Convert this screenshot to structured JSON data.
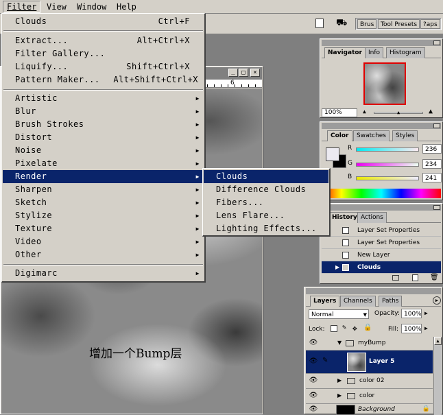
{
  "menubar": {
    "items": [
      "Filter",
      "View",
      "Window",
      "Help"
    ]
  },
  "options_bar": {
    "tabs": [
      "Brus",
      "Tool Presets",
      "?aps"
    ]
  },
  "filter_menu": {
    "top": {
      "label": "Clouds",
      "shortcut": "Ctrl+F"
    },
    "group1": [
      {
        "label": "Extract...",
        "shortcut": "Alt+Ctrl+X"
      },
      {
        "label": "Filter Gallery...",
        "shortcut": ""
      },
      {
        "label": "Liquify...",
        "shortcut": "Shift+Ctrl+X"
      },
      {
        "label": "Pattern Maker...",
        "shortcut": "Alt+Shift+Ctrl+X"
      }
    ],
    "group2": [
      "Artistic",
      "Blur",
      "Brush Strokes",
      "Distort",
      "Noise",
      "Pixelate",
      "Render",
      "Sharpen",
      "Sketch",
      "Stylize",
      "Texture",
      "Video",
      "Other"
    ],
    "group3": [
      "Digimarc"
    ]
  },
  "render_submenu": [
    "Clouds",
    "Difference Clouds",
    "Fibers...",
    "Lens Flare...",
    "Lighting Effects..."
  ],
  "document": {
    "ruler_mark": "6"
  },
  "caption": "增加一个Bump层",
  "navigator": {
    "tabs": [
      "Navigator",
      "Info",
      "Histogram"
    ],
    "zoom": "100%"
  },
  "color": {
    "tabs": [
      "Color",
      "Swatches",
      "Styles"
    ],
    "channels": [
      {
        "label": "R",
        "value": "236"
      },
      {
        "label": "G",
        "value": "234"
      },
      {
        "label": "B",
        "value": "241"
      }
    ]
  },
  "history": {
    "tabs": [
      "History",
      "Actions"
    ],
    "items": [
      "Layer Set Properties",
      "Layer Set Properties",
      "New Layer",
      "Clouds"
    ]
  },
  "layers": {
    "tabs": [
      "Layers",
      "Channels",
      "Paths"
    ],
    "blend_mode": "Normal",
    "opacity_label": "Opacity:",
    "opacity": "100%",
    "lock_label": "Lock:",
    "fill_label": "Fill:",
    "fill": "100%",
    "rows": [
      {
        "name": "myBump",
        "type": "set"
      },
      {
        "name": "Layer 5",
        "type": "layer"
      },
      {
        "name": "color 02",
        "type": "set"
      },
      {
        "name": "color",
        "type": "set"
      },
      {
        "name": "Background",
        "type": "background"
      }
    ]
  },
  "colors": {
    "menu_highlight": "#0a246a",
    "panel_bg": "#d4d0c8",
    "workspace": "#7f7f7f"
  }
}
